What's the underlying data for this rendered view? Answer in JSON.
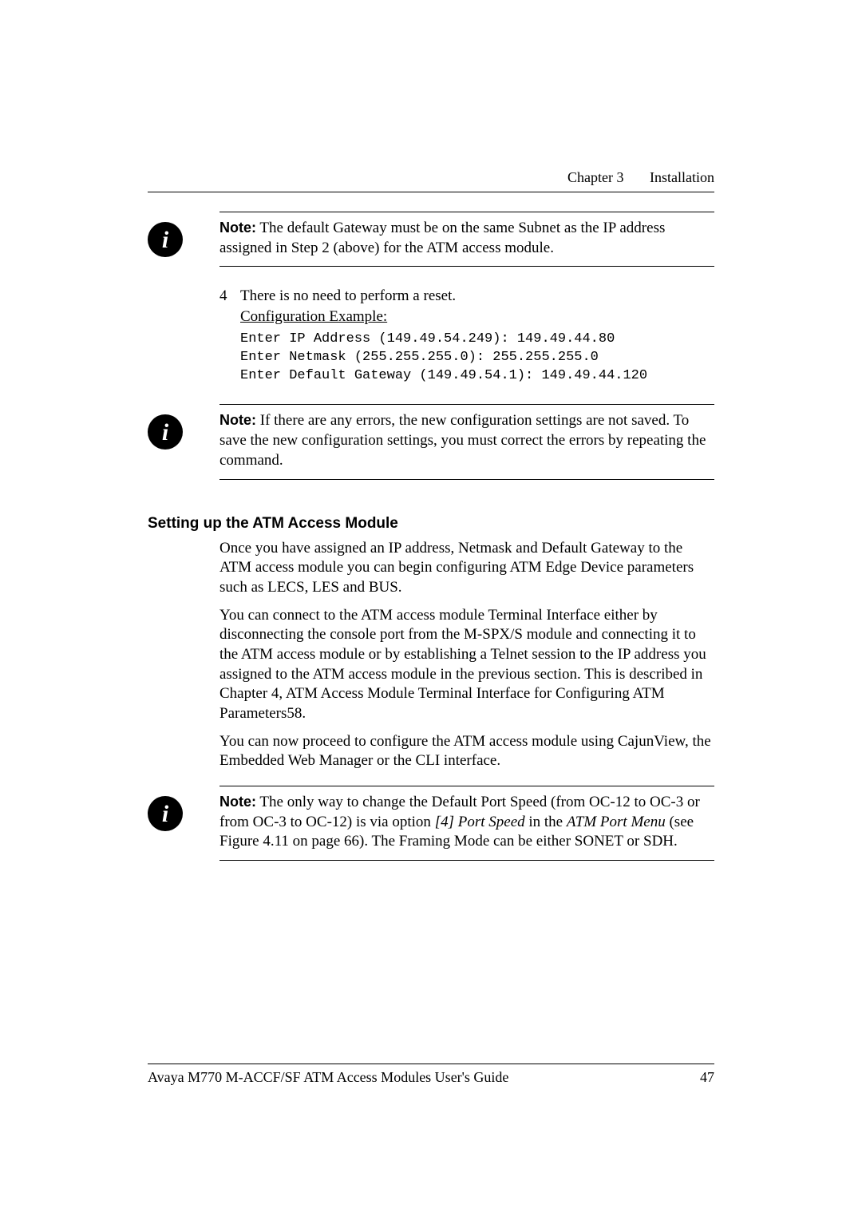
{
  "header": {
    "chapter": "Chapter 3",
    "title": "Installation"
  },
  "note1": {
    "label": "Note:",
    "text": "The default Gateway must be on the same Subnet as the IP address assigned in Step 2 (above) for the ATM access module."
  },
  "step4": {
    "num": "4",
    "line1": "There is no need to perform a reset.",
    "line2": "Configuration Example:",
    "code": "Enter IP Address (149.49.54.249): 149.49.44.80\nEnter Netmask (255.255.255.0): 255.255.255.0\nEnter Default Gateway (149.49.54.1): 149.49.44.120"
  },
  "note2": {
    "label": "Note:",
    "text": "If there are any errors, the new configuration settings are not saved. To save the new configuration settings, you must correct the errors by repeating the command."
  },
  "section": {
    "heading": "Setting up the ATM Access Module",
    "p1": "Once you have assigned an IP address, Netmask and Default Gateway to the ATM access module you can begin configuring ATM Edge Device parameters such as LECS, LES and BUS.",
    "p2": "You can connect to the ATM access module Terminal Interface either by disconnecting the console port from the M-SPX/S module and connecting it to the ATM access module or by establishing a Telnet session to the IP address you assigned to the ATM access module in the previous section. This is described in Chapter 4, ATM Access Module Terminal Interface for Configuring ATM Parameters58.",
    "p3": "You can now proceed to configure the ATM access module using CajunView, the Embedded Web Manager or the CLI interface."
  },
  "note3": {
    "label": "Note:",
    "pre": "The only way to change the Default Port Speed (from OC-12 to OC-3 or from OC-3 to OC-12) is via option ",
    "opt": "[4] Port Speed",
    "mid": " in the ",
    "menu": "ATM Port Menu",
    "post": " (see Figure 4.11 on page 66). The Framing Mode can be either SONET or SDH."
  },
  "footer": {
    "text": "Avaya M770 M-ACCF/SF ATM Access Modules User's Guide",
    "page": "47"
  }
}
